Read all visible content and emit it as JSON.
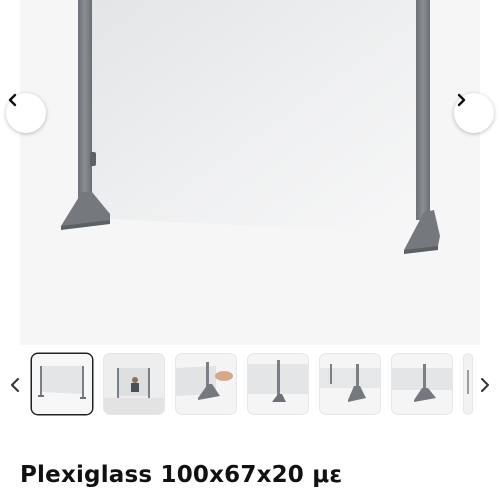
{
  "product": {
    "title": "Plexiglass 100x67x20 με"
  },
  "gallery": {
    "thumbnails": [
      {
        "subject": "full-screen-view",
        "active": true
      },
      {
        "subject": "person-behind-screen",
        "active": false
      },
      {
        "subject": "hand-adjusting-foot",
        "active": false
      },
      {
        "subject": "single-post-view",
        "active": false
      },
      {
        "subject": "foot-closeup",
        "active": false
      },
      {
        "subject": "foot-detail",
        "active": false
      },
      {
        "subject": "partial-thumbnail",
        "active": false
      }
    ]
  },
  "icons": {
    "prev": "chevron-left-icon",
    "next": "chevron-right-icon"
  },
  "colors": {
    "frame": "#7b7e82",
    "panel": "#e9eaeb",
    "background": "#f6f6f6"
  }
}
